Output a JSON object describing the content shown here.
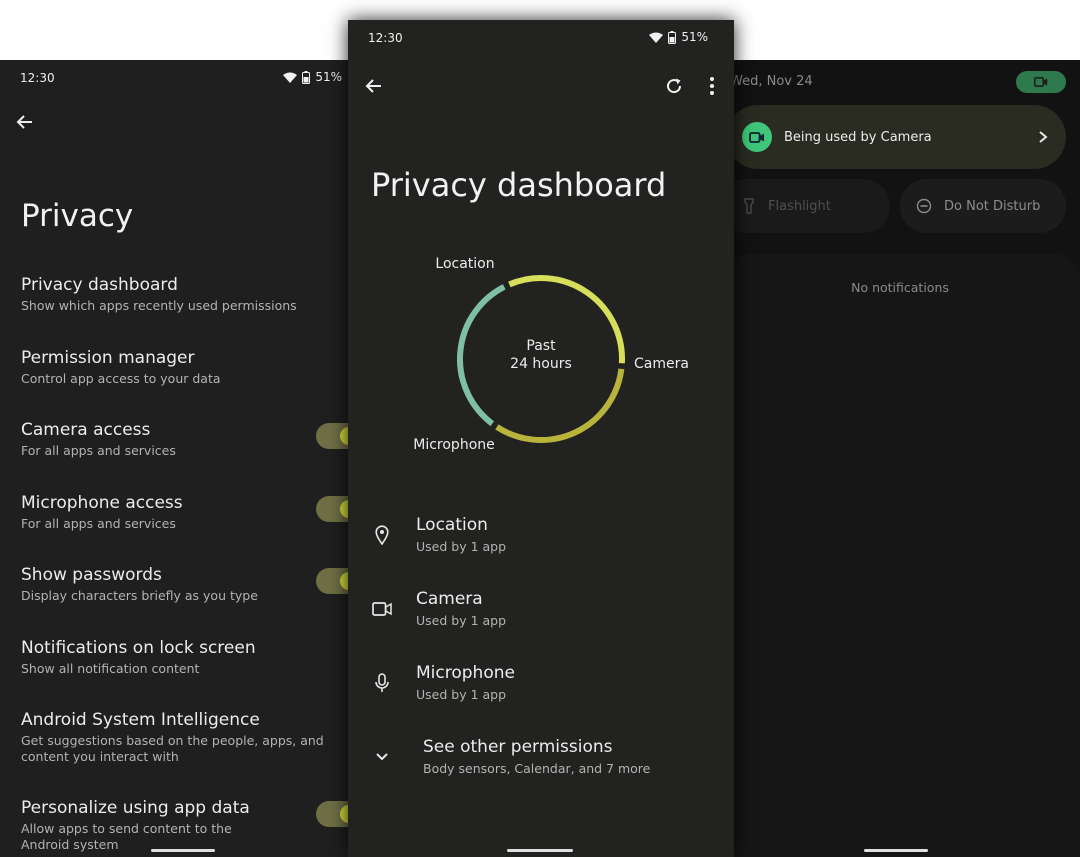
{
  "left": {
    "status": {
      "time": "12:30",
      "battery": "51%"
    },
    "title": "Privacy",
    "items": [
      {
        "title": "Privacy dashboard",
        "subtitle": "Show which apps recently used permissions",
        "toggle": false
      },
      {
        "title": "Permission manager",
        "subtitle": "Control app access to your data",
        "toggle": false
      },
      {
        "title": "Camera access",
        "subtitle": "For all apps and services",
        "toggle": true
      },
      {
        "title": "Microphone access",
        "subtitle": "For all apps and services",
        "toggle": true
      },
      {
        "title": "Show passwords",
        "subtitle": "Display characters briefly as you type",
        "toggle": true
      },
      {
        "title": "Notifications on lock screen",
        "subtitle": "Show all notification content",
        "toggle": false
      },
      {
        "title": "Android System Intelligence",
        "subtitle": "Get suggestions based on the people, apps, and content you interact with",
        "toggle": false
      },
      {
        "title": "Personalize using app data",
        "subtitle": "Allow apps to send content to the Android system",
        "toggle": true
      }
    ]
  },
  "center": {
    "status": {
      "time": "12:30",
      "battery": "51%"
    },
    "title": "Privacy dashboard",
    "chart_data": {
      "type": "pie",
      "center_label_line1": "Past",
      "center_label_line2": "24 hours",
      "segments": [
        {
          "name": "Location",
          "value": 1,
          "color": "#7fbfa5"
        },
        {
          "name": "Camera",
          "value": 1,
          "color": "#d7df5a"
        },
        {
          "name": "Microphone",
          "value": 1,
          "color": "#b8b33a"
        }
      ]
    },
    "permissions": [
      {
        "title": "Location",
        "subtitle": "Used by 1 app",
        "icon": "location-pin-icon"
      },
      {
        "title": "Camera",
        "subtitle": "Used by 1 app",
        "icon": "camera-icon"
      },
      {
        "title": "Microphone",
        "subtitle": "Used by 1 app",
        "icon": "microphone-icon"
      },
      {
        "title": "See other permissions",
        "subtitle": "Body sensors, Calendar, and 7 more",
        "icon": "chevron-down-icon"
      }
    ]
  },
  "right": {
    "date": "Wed, Nov 24",
    "ongoing": "Being used by Camera",
    "tiles": [
      {
        "label": "Flashlight",
        "icon": "flashlight-icon"
      },
      {
        "label": "Do Not Disturb",
        "icon": "do-not-disturb-icon"
      }
    ],
    "empty_text": "No notifications"
  },
  "colors": {
    "accent_green": "#3ec77a",
    "toggle_thumb": "#d6dc3a",
    "toggle_track": "#6f6f45"
  }
}
